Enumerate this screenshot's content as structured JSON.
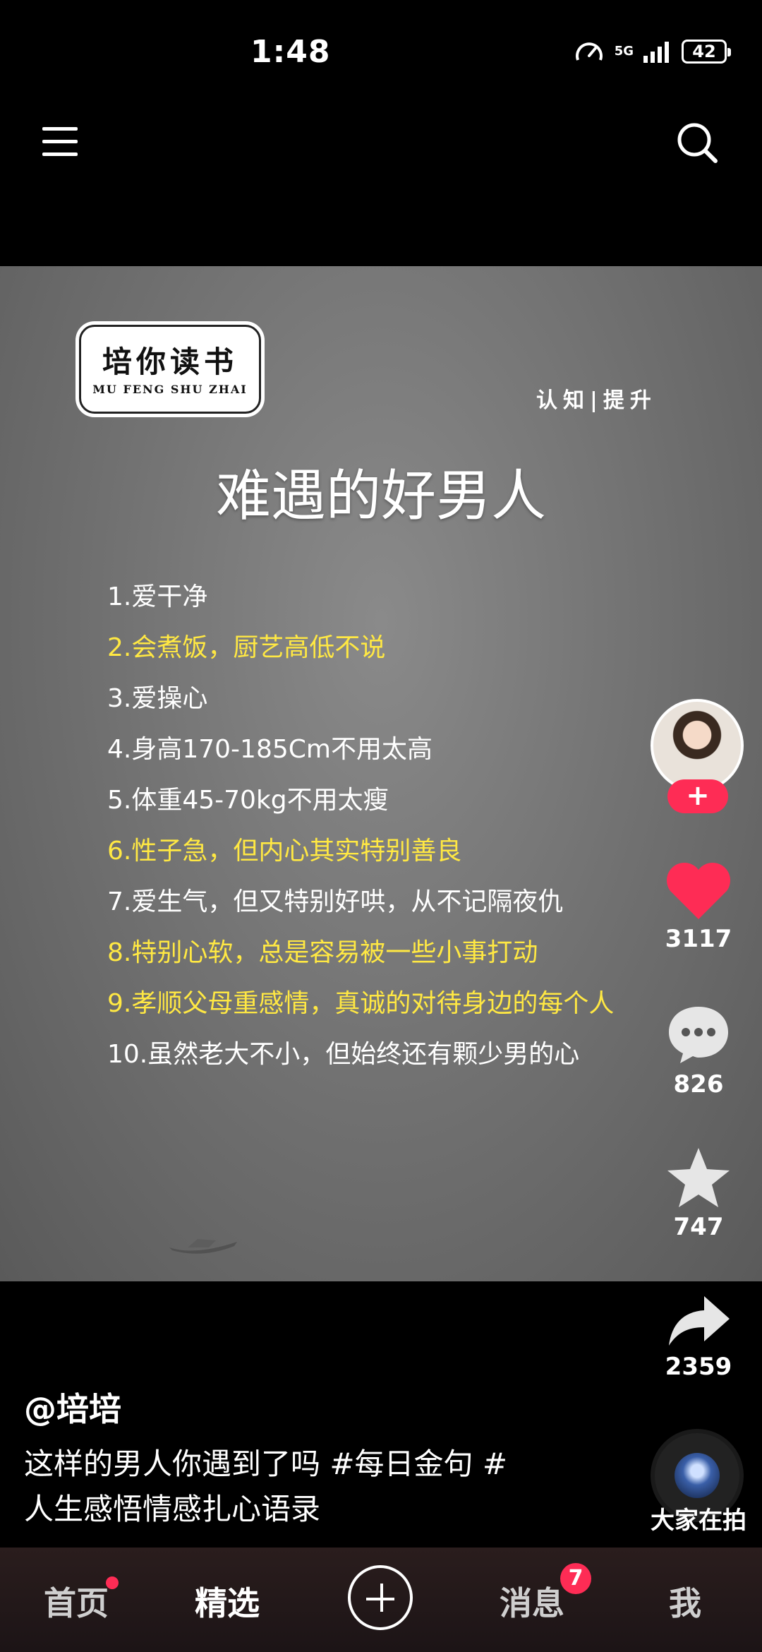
{
  "status_bar": {
    "time": "1:48",
    "network": "5G",
    "battery": "42"
  },
  "video": {
    "logo_main": "培你读书",
    "logo_sub": "MU FENG SHU ZHAI",
    "slogan": "认知|提升",
    "headline": "难遇的好男人",
    "items": [
      {
        "text": "1.爱干净",
        "highlight": false
      },
      {
        "text": "2.会煮饭，厨艺高低不说",
        "highlight": true
      },
      {
        "text": "3.爱操心",
        "highlight": false
      },
      {
        "text": "4.身高170-185Cm不用太高",
        "highlight": false
      },
      {
        "text": "5.体重45-70kg不用太瘦",
        "highlight": false
      },
      {
        "text": "6.性子急，但内心其实特别善良",
        "highlight": true
      },
      {
        "text": "7.爱生气，但又特别好哄，从不记隔夜仇",
        "highlight": false
      },
      {
        "text": "8.特别心软，总是容易被一些小事打动",
        "highlight": true
      },
      {
        "text": "9.孝顺父母重感情，真诚的对待身边的每个人",
        "highlight": true
      },
      {
        "text": "10.虽然老大不小，但始终还有颗少男的心",
        "highlight": false
      }
    ],
    "highlight_color": "#ffe843"
  },
  "actions": {
    "likes": "3117",
    "comments": "826",
    "favorites": "747",
    "shares": "2359",
    "like_color": "#fe2c55"
  },
  "post": {
    "author": "@培培",
    "description": "这样的男人你遇到了吗 #每日金句 #人生感悟情感扎心语录"
  },
  "music": {
    "label": "大家在拍"
  },
  "nav": {
    "home": "首页",
    "featured": "精选",
    "messages": "消息",
    "messages_badge": "7",
    "me": "我"
  }
}
